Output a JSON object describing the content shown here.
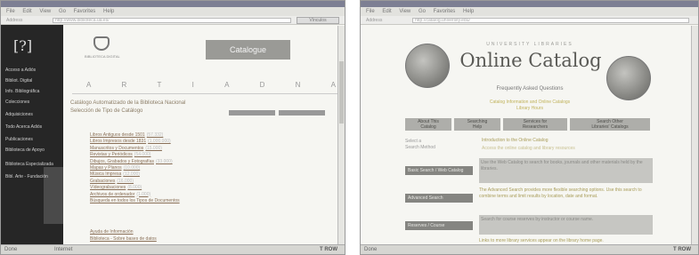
{
  "left": {
    "menu_items": [
      "File",
      "Edit",
      "View",
      "Go",
      "Favorites",
      "Help"
    ],
    "address_label": "Address",
    "address_value": "http://www.biblioteca.ua.es/",
    "go_label": "Vínculos",
    "sidebar_logo": "[?]",
    "sidebar_items": [
      "Acceso a Adiós",
      "Bibliot. Digital",
      "Info. Bibliográfica",
      "Colecciones",
      "Adquisiciones",
      "Todo Acerca Adiós",
      "Publicaciones",
      "Biblioteca de Apoyo",
      "Biblioteca Especializada",
      "Bibl. Arte - Fundación"
    ],
    "crest_caption": "BIBLIOTECA DIGITAL",
    "catalogue_button": "Catalogue",
    "letters": [
      "A",
      "R",
      "T",
      "I",
      "A",
      "D",
      "N",
      "A"
    ],
    "intro_line1": "Catálogo Automatizado de la Biblioteca Nacional",
    "intro_line2": "Selección de Tipo de Catálogo",
    "links": [
      {
        "label": "Libros Antiguos desde 1501",
        "count": "(57.332)"
      },
      {
        "label": "Libros Impresos desde 1831",
        "count": "(1.000.000)"
      },
      {
        "label": "Manuscritos y Documentos",
        "count": "(15.000)"
      },
      {
        "label": "Revistas y Periódicos",
        "count": "(54.000)"
      },
      {
        "label": "Dibujos, Grabados y Fotografías",
        "count": "(33.000)"
      },
      {
        "label": "Mapas y Planos",
        "count": "(10.000)"
      },
      {
        "label": "Música Impresa",
        "count": "(12.000)"
      },
      {
        "label": "Grabaciones",
        "count": "(16.000)"
      },
      {
        "label": "Vídeograbaciones",
        "count": "(8.000)"
      },
      {
        "label": "Archivos de ordenador",
        "count": "(1.000)"
      },
      {
        "label": "Búsqueda en todos los Tipos de Documentos",
        "count": ""
      }
    ],
    "footer_link1": "Ayuda de Información",
    "footer_link2": "Biblioteca - Sobre bases de datos",
    "status_left": "Done",
    "status_mid": "Internet",
    "status_right": "T ROW"
  },
  "right": {
    "menu_items": [
      "File",
      "Edit",
      "View",
      "Go",
      "Favorites",
      "Help"
    ],
    "address_label": "Address",
    "address_value": "http://catalog.university.edu/",
    "university_line": "UNIVERSITY LIBRARIES",
    "catalog_title": "Online Catalog",
    "catalog_subtitle": "Frequently Asked Questions",
    "note_line1": "Catalog Information and Online Catalogs",
    "note_line2": "Library Hours",
    "nav_buttons": [
      {
        "line1": "About This",
        "line2": "Catalog"
      },
      {
        "line1": "Searching",
        "line2": "Help"
      },
      {
        "line1": "Services for",
        "line2": "Researchers"
      },
      {
        "line1": "Search Other",
        "line2": "Libraries' Catalogs"
      }
    ],
    "side_links": [
      "Select a",
      "Search Method"
    ],
    "top_line": "Introduction to the Online Catalog",
    "top_line2": "Access the online catalog and library resources",
    "options": [
      "Basic Search / Web Catalog",
      "Advanced Search",
      "Reserves / Course"
    ],
    "descriptions": [
      "Use the Web Catalog to search for books, journals and other materials held by the libraries.",
      "The Advanced Search provides more flexible searching options. Use this search to combine terms and limit results by location, date and format.",
      "Search for course reserves by instructor or course name."
    ],
    "bottom_note": "Links to more library services appear on the library home page.",
    "status_left": "Done",
    "status_right": "T ROW"
  }
}
